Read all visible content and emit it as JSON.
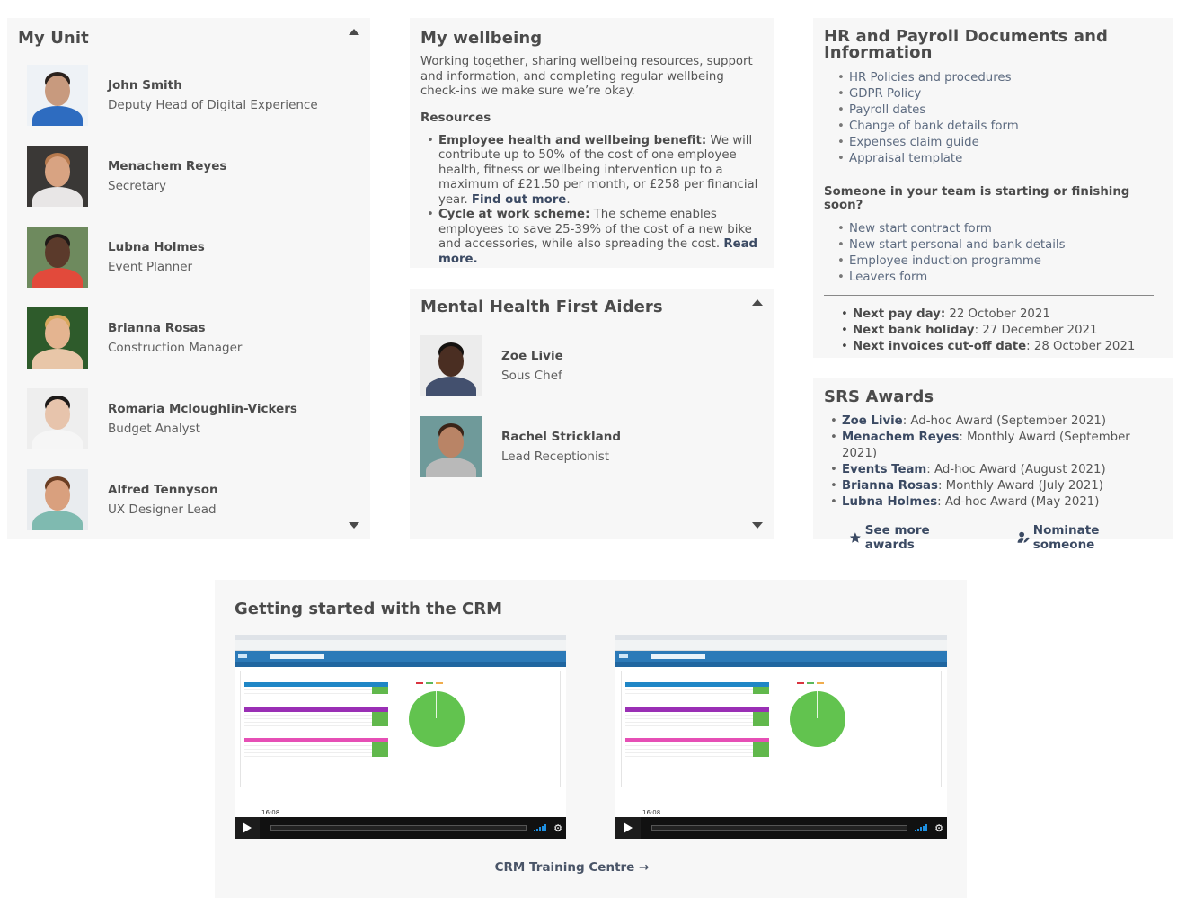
{
  "my_unit": {
    "title": "My Unit",
    "people": [
      {
        "name": "John Smith",
        "role": "Deputy Head of Digital Experience",
        "bg": "#eef2f6",
        "hair": "#2a211c",
        "skin": "#c89a7e",
        "shirt": "#2e6cc0"
      },
      {
        "name": "Menachem Reyes",
        "role": "Secretary",
        "bg": "#3a3836",
        "hair": "#b77a4e",
        "skin": "#d8a382",
        "shirt": "#e8e6e6"
      },
      {
        "name": "Lubna Holmes",
        "role": "Event Planner",
        "bg": "#6e8a5e",
        "hair": "#1f1a17",
        "skin": "#5b3a2b",
        "shirt": "#e24a3b"
      },
      {
        "name": "Brianna Rosas",
        "role": "Construction Manager",
        "bg": "#2e5b2b",
        "hair": "#d8a85e",
        "skin": "#e4b490",
        "shirt": "#e8c6a8"
      },
      {
        "name": "Romaria Mcloughlin-Vickers",
        "role": "Budget Analyst",
        "bg": "#eeeeee",
        "hair": "#1d1a19",
        "skin": "#e7c4ac",
        "shirt": "#f6f6f6"
      },
      {
        "name": "Alfred Tennyson",
        "role": "UX Designer Lead",
        "bg": "#e9ecef",
        "hair": "#6a3d22",
        "skin": "#d9a07e",
        "shirt": "#7fbab0"
      }
    ]
  },
  "wellbeing": {
    "title": "My wellbeing",
    "intro": "Working together, sharing wellbeing resources, support and information, and completing regular wellbeing check-ins we make sure we’re okay.",
    "resources_heading": "Resources",
    "items": [
      {
        "label": "Employee health and wellbeing benefit:",
        "text": " We will contribute up to 50% of the cost of one employee health, fitness or wellbeing intervention up to a maximum of £21.50 per month, or £258 per financial year. ",
        "link": "Find out more",
        "after": "."
      },
      {
        "label": "Cycle at work scheme:",
        "text": " The scheme enables employees to save 25-39% of the cost of a new bike and accessories, while also spreading the cost. ",
        "link": "Read more.",
        "after": ""
      }
    ]
  },
  "mhfa": {
    "title": "Mental Health First Aiders",
    "people": [
      {
        "name": "Zoe Livie",
        "role": "Sous Chef",
        "bg": "#ececec",
        "hair": "#151210",
        "skin": "#4a2e22",
        "shirt": "#43506e"
      },
      {
        "name": "Rachel Strickland",
        "role": "Lead Receptionist",
        "bg": "#6f9a9a",
        "hair": "#3a2418",
        "skin": "#b98466",
        "shirt": "#b9b9b9"
      }
    ]
  },
  "hr": {
    "title": "HR and Payroll Documents and Information",
    "links": [
      "HR Policies and procedures",
      "GDPR Policy",
      "Payroll dates",
      "Change of bank details form",
      "Expenses claim guide",
      "Appraisal template"
    ],
    "team_heading": "Someone in your team is starting or finishing soon?",
    "team_links": [
      "New start contract form",
      "New start personal and bank details",
      "Employee induction programme",
      "Leavers form"
    ],
    "facts": [
      {
        "label": "Next pay day:",
        "value": " 22 October 2021"
      },
      {
        "label": "Next bank holiday",
        "value": ": 27 December 2021"
      },
      {
        "label": "Next invoices cut-off date",
        "value": ":  28 October 2021"
      }
    ]
  },
  "awards": {
    "title": "SRS Awards",
    "items": [
      {
        "name": "Zoe Livie",
        "text": ": Ad-hoc Award (September 2021)"
      },
      {
        "name": "Menachem Reyes",
        "text": ": Monthly Award (September 2021)"
      },
      {
        "name": "Events Team",
        "text": ": Ad-hoc Award (August 2021)"
      },
      {
        "name": "Brianna Rosas",
        "text": ": Monthly Award (July 2021)"
      },
      {
        "name": "Lubna Holmes",
        "text": ": Ad-hoc Award (May 2021)"
      }
    ],
    "see_more": "See more awards",
    "nominate": "Nominate someone"
  },
  "crm": {
    "title": "Getting started with the CRM",
    "videos": [
      {
        "duration": "16:08",
        "header_colors": [
          "#1f86c6",
          "#9a2fb5",
          "#e64fb5"
        ],
        "legend_colors": [
          "#d9333f",
          "#5cb85c",
          "#f0ad4e"
        ]
      },
      {
        "duration": "16:08",
        "header_colors": [
          "#1f86c6",
          "#9a2fb5",
          "#e64fb5"
        ],
        "legend_colors": [
          "#d9333f",
          "#5cb85c",
          "#f0ad4e"
        ]
      }
    ],
    "link": "CRM Training Centre",
    "link_arrow": "→"
  }
}
